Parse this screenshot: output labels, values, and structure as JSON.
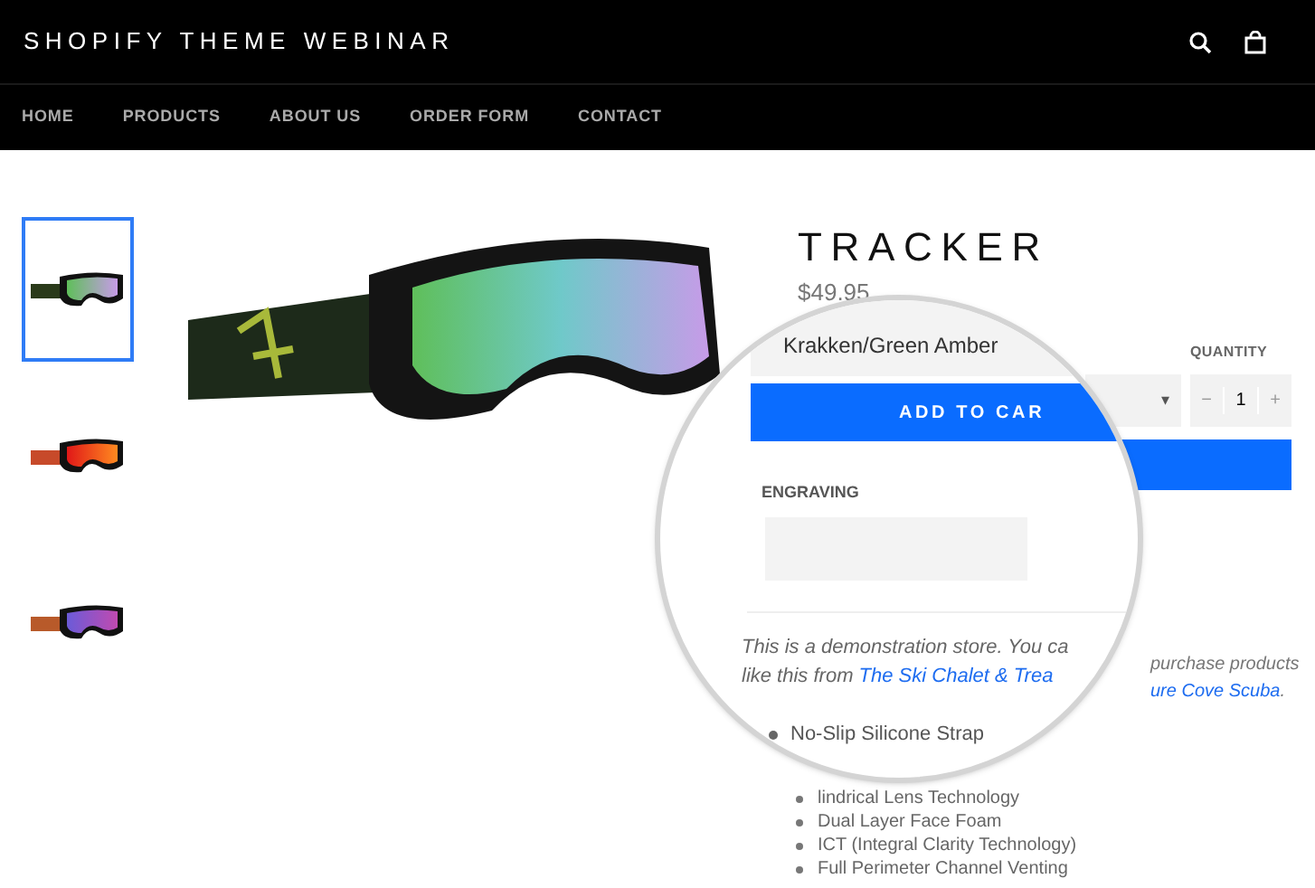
{
  "header": {
    "title": "SHOPIFY THEME WEBINAR"
  },
  "nav": [
    {
      "label": "HOME"
    },
    {
      "label": "PRODUCTS"
    },
    {
      "label": "ABOUT US"
    },
    {
      "label": "ORDER FORM"
    },
    {
      "label": "CONTACT"
    }
  ],
  "thumbnails": [
    {
      "selected": true,
      "kind": "green"
    },
    {
      "selected": false,
      "kind": "red"
    },
    {
      "selected": false,
      "kind": "purple"
    }
  ],
  "product": {
    "title": "TRACKER",
    "price": "$49.95",
    "quantity_label": "QUANTITY",
    "quantity": "1",
    "minus": "−",
    "plus": "+",
    "dropdown_caret": "▾",
    "description_tail": "purchase products",
    "link_tail": "ure Cove Scuba",
    "link_end": ".",
    "features": [
      "lindrical Lens Technology",
      "Dual Layer Face Foam",
      "ICT (Integral Clarity Technology)",
      "Full Perimeter Channel Venting"
    ]
  },
  "magnifier": {
    "variant": "Krakken/Green Amber",
    "add_to_cart": "ADD TO CAR",
    "engraving_label": "ENGRAVING",
    "description_line_1": "This is a demonstration store. You ca",
    "description_line_2": "like this from ",
    "link": "The Ski Chalet & Trea",
    "feature": "No-Slip Silicone Strap"
  }
}
